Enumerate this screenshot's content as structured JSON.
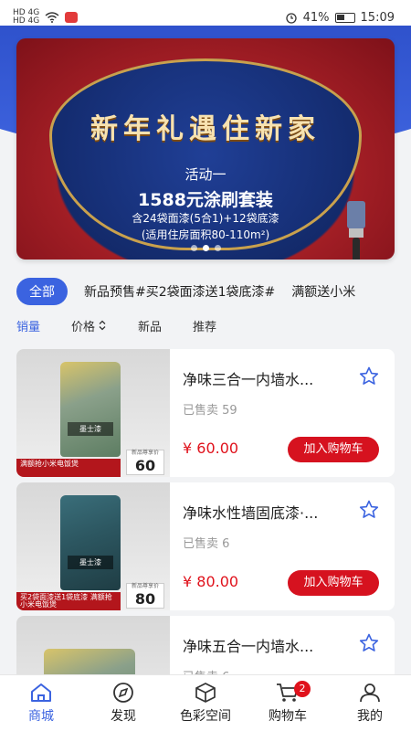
{
  "status_bar": {
    "signal_1": "HD 4G",
    "signal_2": "HD 4G",
    "battery_pct": "41%",
    "time": "15:09"
  },
  "banner": {
    "title": "新年礼遇住新家",
    "activity": "活动一",
    "promo": "1588元涂刷套装",
    "detail": "含24袋面漆(5合1)+12袋底漆",
    "area": "(适用住房面积80-110m²)",
    "page_count": 3,
    "active_page": 1
  },
  "categories": {
    "active": "全部",
    "items": [
      "新品预售#买2袋面漆送1袋底漆#",
      "满额送小米"
    ]
  },
  "sort": {
    "items": [
      {
        "label": "销量",
        "active": true
      },
      {
        "label": "价格",
        "active": false
      },
      {
        "label": "新品",
        "active": false
      },
      {
        "label": "推荐",
        "active": false
      }
    ]
  },
  "products": [
    {
      "name": "净味三合一内墙水...",
      "sold": "已售卖 59",
      "price": "¥ 60.00",
      "cart_label": "加入购物车",
      "img_brand": "墨士漆",
      "img_promo": "满额抢小米电饭煲",
      "img_price": "60",
      "img_price_caption": "新品尊享价"
    },
    {
      "name": "净味水性墙固底漆·...",
      "sold": "已售卖 6",
      "price": "¥ 80.00",
      "cart_label": "加入购物车",
      "img_brand": "墨士漆",
      "img_promo": "买2袋面漆送1袋底漆 满额抢小米电饭煲",
      "img_price": "80",
      "img_price_caption": "新品尊享价"
    },
    {
      "name": "净味五合一内墙水...",
      "sold": "已售卖 6",
      "price": "",
      "cart_label": "",
      "img_brand": "",
      "img_promo": "",
      "img_price": "",
      "img_price_caption": ""
    }
  ],
  "bottom_nav": {
    "items": [
      {
        "label": "商城",
        "icon": "home-icon",
        "active": true
      },
      {
        "label": "发现",
        "icon": "compass-icon",
        "active": false
      },
      {
        "label": "色彩空间",
        "icon": "cube-icon",
        "active": false
      },
      {
        "label": "购物车",
        "icon": "cart-icon",
        "active": false,
        "badge": "2"
      },
      {
        "label": "我的",
        "icon": "user-icon",
        "active": false
      }
    ]
  },
  "colors": {
    "accent": "#3b63e0",
    "price_red": "#e0121c",
    "cart_btn": "#d6121f"
  }
}
